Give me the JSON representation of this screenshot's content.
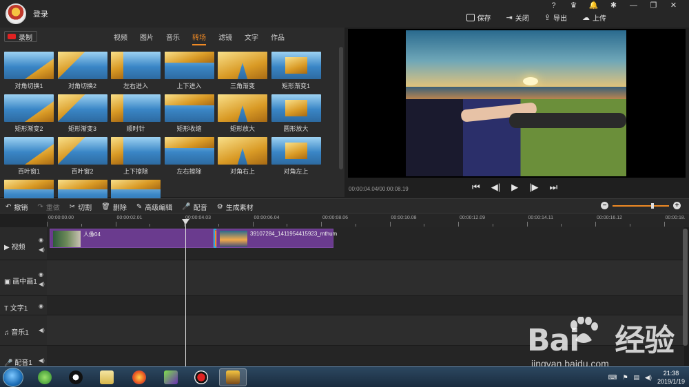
{
  "title_bar": {
    "login_label": "登录",
    "window_buttons": [
      "?",
      "VIP",
      "bell-icon",
      "gear-icon",
      "minimize-icon",
      "maximize-icon",
      "close-icon"
    ]
  },
  "actions": {
    "save": "保存",
    "close": "关闭",
    "export": "导出",
    "upload": "上传"
  },
  "library": {
    "record_label": "录制",
    "tabs": [
      {
        "label": "视频",
        "active": false
      },
      {
        "label": "图片",
        "active": false
      },
      {
        "label": "音乐",
        "active": false
      },
      {
        "label": "转场",
        "active": true
      },
      {
        "label": "滤镜",
        "active": false
      },
      {
        "label": "文字",
        "active": false
      },
      {
        "label": "作品",
        "active": false
      }
    ],
    "transitions": [
      "对角切换1",
      "对角切换2",
      "左右进入",
      "上下进入",
      "三角渐变",
      "矩形渐变1",
      "矩形渐变2",
      "矩形渐变3",
      "顺时针",
      "矩形收缩",
      "矩形放大",
      "圆形放大",
      "百叶窗1",
      "百叶窗2",
      "上下擦除",
      "左右擦除",
      "对角右上",
      "对角左上",
      "",
      "",
      ""
    ]
  },
  "preview": {
    "time_readout": "00:00:04.04/00:00:08.19"
  },
  "edit_toolbar": {
    "undo": "撤销",
    "redo": "重做",
    "cut": "切割",
    "delete": "删除",
    "advanced_edit": "高级编辑",
    "dub": "配音",
    "generate": "生成素材",
    "zoom_level": 0.72
  },
  "ruler": [
    "00:00:00.00",
    "00:00:02.01",
    "00:00:04.03",
    "00:00:06.04",
    "00:00:08.06",
    "00:00:10.08",
    "00:00:12.09",
    "00:00:14.11",
    "00:00:16.12",
    "00:00:18."
  ],
  "tracks": {
    "video": "视频",
    "pip": "画中画1",
    "text": "文字1",
    "music": "音乐1",
    "voice": "配音1",
    "clip1_name": "人像04",
    "clip2_name": "39107284_1411954415923_mthum"
  },
  "taskbar": {
    "time": "21:38",
    "date": "2019/1/19"
  },
  "watermark": {
    "brand": "Bai du 经验",
    "brand_left": "Bai",
    "brand_right": "经验",
    "url": "jingyan.baidu.com"
  }
}
